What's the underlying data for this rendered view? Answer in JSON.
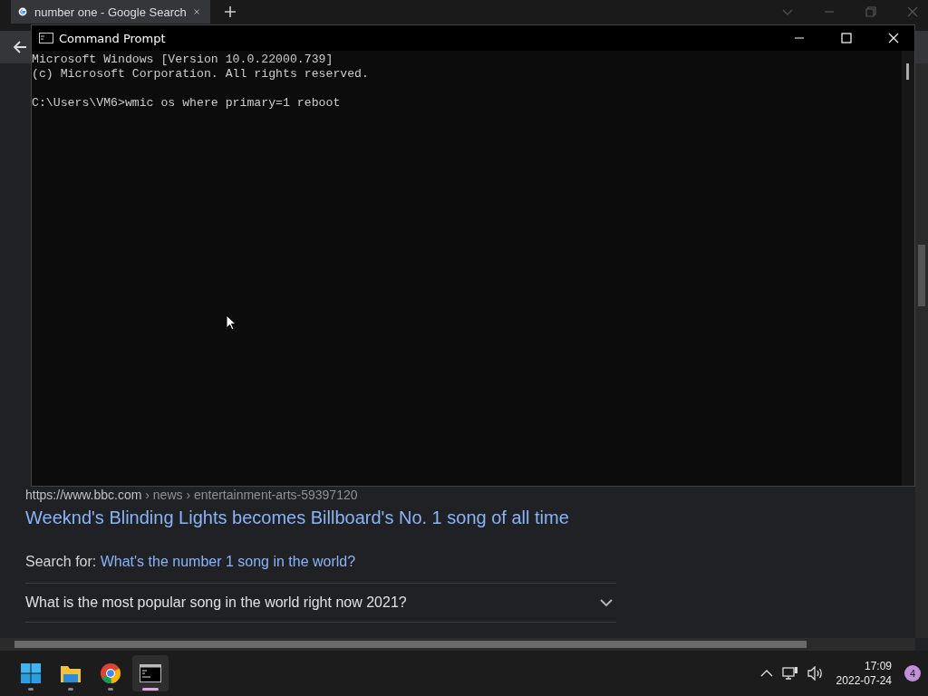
{
  "browser": {
    "tabs": [
      {
        "title": "number one - Google Search",
        "selected": true
      }
    ],
    "result": {
      "site": "https://www.bbc.com",
      "path": " › news › entertainment-arts-59397120",
      "title": "Weeknd's Blinding Lights becomes Billboard's No. 1 song of all time"
    },
    "search_for": {
      "label": "Search for:",
      "link": "What's the number 1 song in the world?"
    },
    "questions": [
      {
        "text": "What is the most popular song in the world right now 2021?",
        "expanded": false
      }
    ]
  },
  "console": {
    "title": "Command Prompt",
    "lines": [
      "Microsoft Windows [Version 10.0.22000.739]",
      "(c) Microsoft Corporation. All rights reserved."
    ],
    "command": "C:\\Users\\VM6>wmic os where primary=1 reboot"
  },
  "taskbar": {
    "apps": [
      {
        "kind": "start",
        "selected": false
      },
      {
        "kind": "files",
        "selected": false
      },
      {
        "kind": "chrome",
        "selected": false
      },
      {
        "kind": "terminal",
        "selected": true
      }
    ],
    "time": "17:09",
    "date": "2022-07-24",
    "notifications": "4"
  }
}
